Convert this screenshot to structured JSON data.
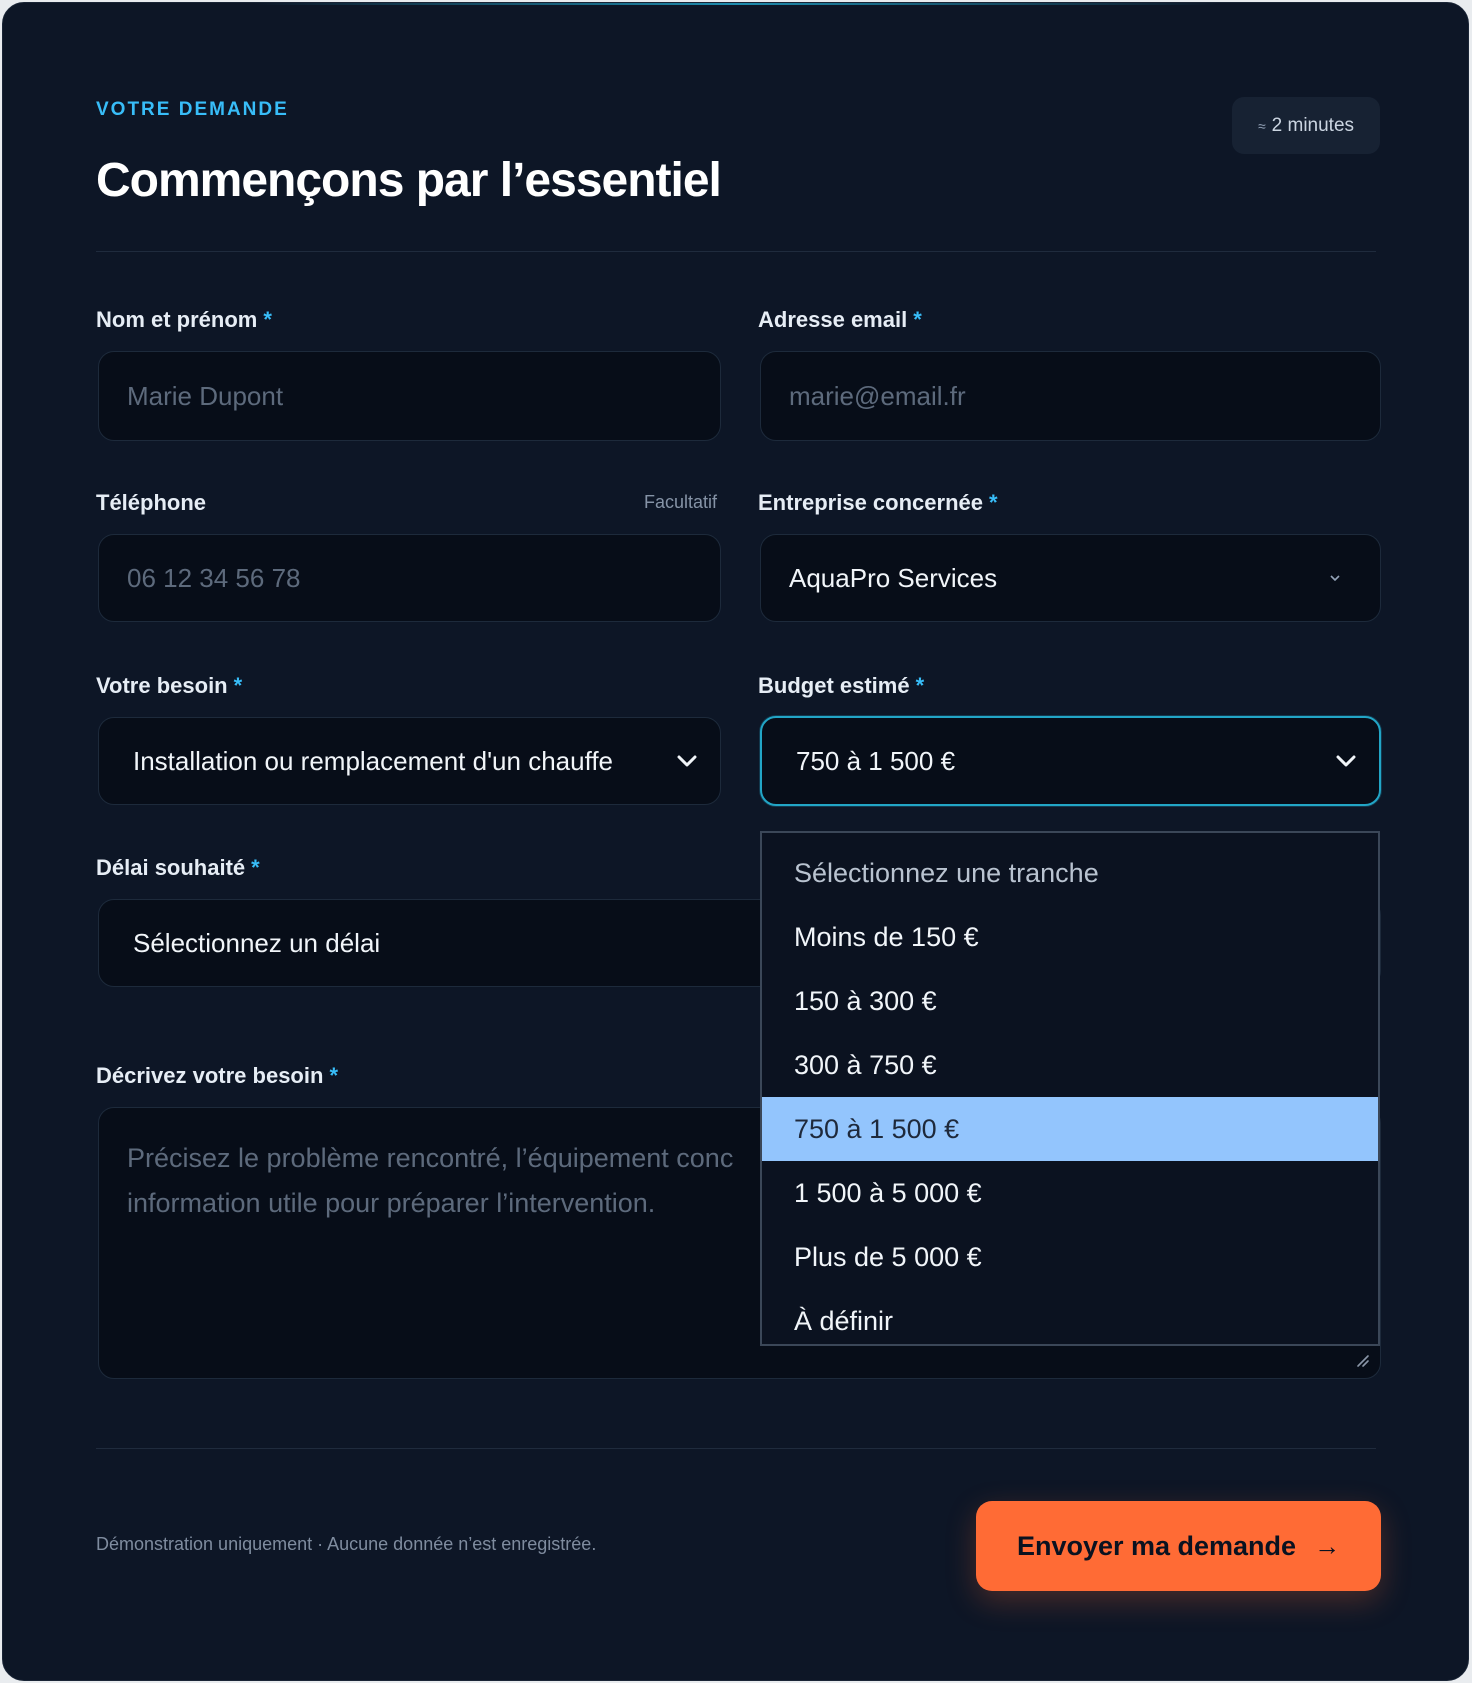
{
  "header": {
    "eyebrow": "VOTRE DEMANDE",
    "title": "Commençons par l’essentiel",
    "time_approx": "≈",
    "time_label": "2 minutes"
  },
  "form": {
    "name": {
      "label": "Nom et prénom",
      "required": "*",
      "placeholder": "Marie Dupont"
    },
    "email": {
      "label": "Adresse email",
      "required": "*",
      "placeholder": "marie@email.fr"
    },
    "phone": {
      "label": "Téléphone",
      "optional": "Facultatif",
      "placeholder": "06 12 34 56 78"
    },
    "company": {
      "label": "Entreprise concernée",
      "required": "*",
      "value": "AquaPro Services"
    },
    "need": {
      "label": "Votre besoin",
      "required": "*",
      "value": "Installation ou remplacement d'un chauffe"
    },
    "budget": {
      "label": "Budget estimé",
      "required": "*",
      "value": "750 à 1 500 €",
      "options": [
        "Sélectionnez une tranche",
        "Moins de 150 €",
        "150 à 300 €",
        "300 à 750 €",
        "750 à 1 500 €",
        "1 500 à 5 000 €",
        "Plus de 5 000 €",
        "À définir"
      ],
      "selected_index": 4
    },
    "delay": {
      "label": "Délai souhaité",
      "required": "*",
      "value": "Sélectionnez un délai"
    },
    "description": {
      "label": "Décrivez votre besoin",
      "required": "*",
      "placeholder_line1": "Précisez le problème rencontré, l’équipement conc",
      "placeholder_line2": "information utile pour préparer l’intervention."
    }
  },
  "footer": {
    "note": "Démonstration uniquement · Aucune donnée n’est enregistrée.",
    "submit_label": "Envoyer ma demande",
    "submit_arrow": "→"
  },
  "colors": {
    "accent": "#38bdf8",
    "cta": "#ff6b35",
    "background": "#0d1626",
    "selected_option": "#93c5fd"
  }
}
